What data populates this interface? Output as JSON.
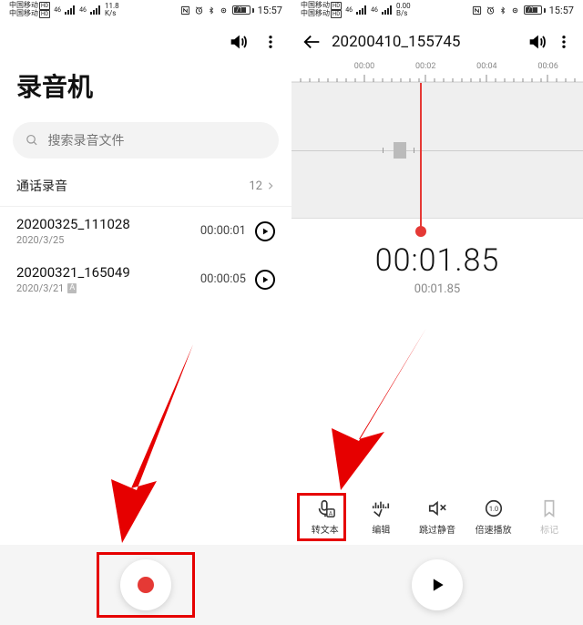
{
  "status": {
    "carrier": "中国移动",
    "net_speed_top": "11.8",
    "net_speed_unit": "K/s",
    "net_speed_top_r": "0.00",
    "net_speed_unit_r": "B/s",
    "battery_pct": "71",
    "time": "15:57",
    "sig_label": "46"
  },
  "left": {
    "title": "录音机",
    "search_placeholder": "搜索录音文件",
    "group_label": "通话录音",
    "group_count": "12",
    "items": [
      {
        "name": "20200325_111028",
        "date": "2020/3/25",
        "dur": "00:00:01",
        "tag": ""
      },
      {
        "name": "20200321_165049",
        "date": "2020/3/21",
        "dur": "00:00:05",
        "tag": "A"
      }
    ]
  },
  "right": {
    "file": "20200410_155745",
    "ticks": [
      "00:00",
      "00:02",
      "00:04",
      "00:06"
    ],
    "big_time": "00:01.85",
    "sub_time": "00:01.85",
    "tools": [
      {
        "key": "to-text",
        "label": "转文本"
      },
      {
        "key": "edit",
        "label": "编辑"
      },
      {
        "key": "skip-silence",
        "label": "跳过静音"
      },
      {
        "key": "speed",
        "label": "倍速播放"
      },
      {
        "key": "mark",
        "label": "标记"
      }
    ]
  }
}
